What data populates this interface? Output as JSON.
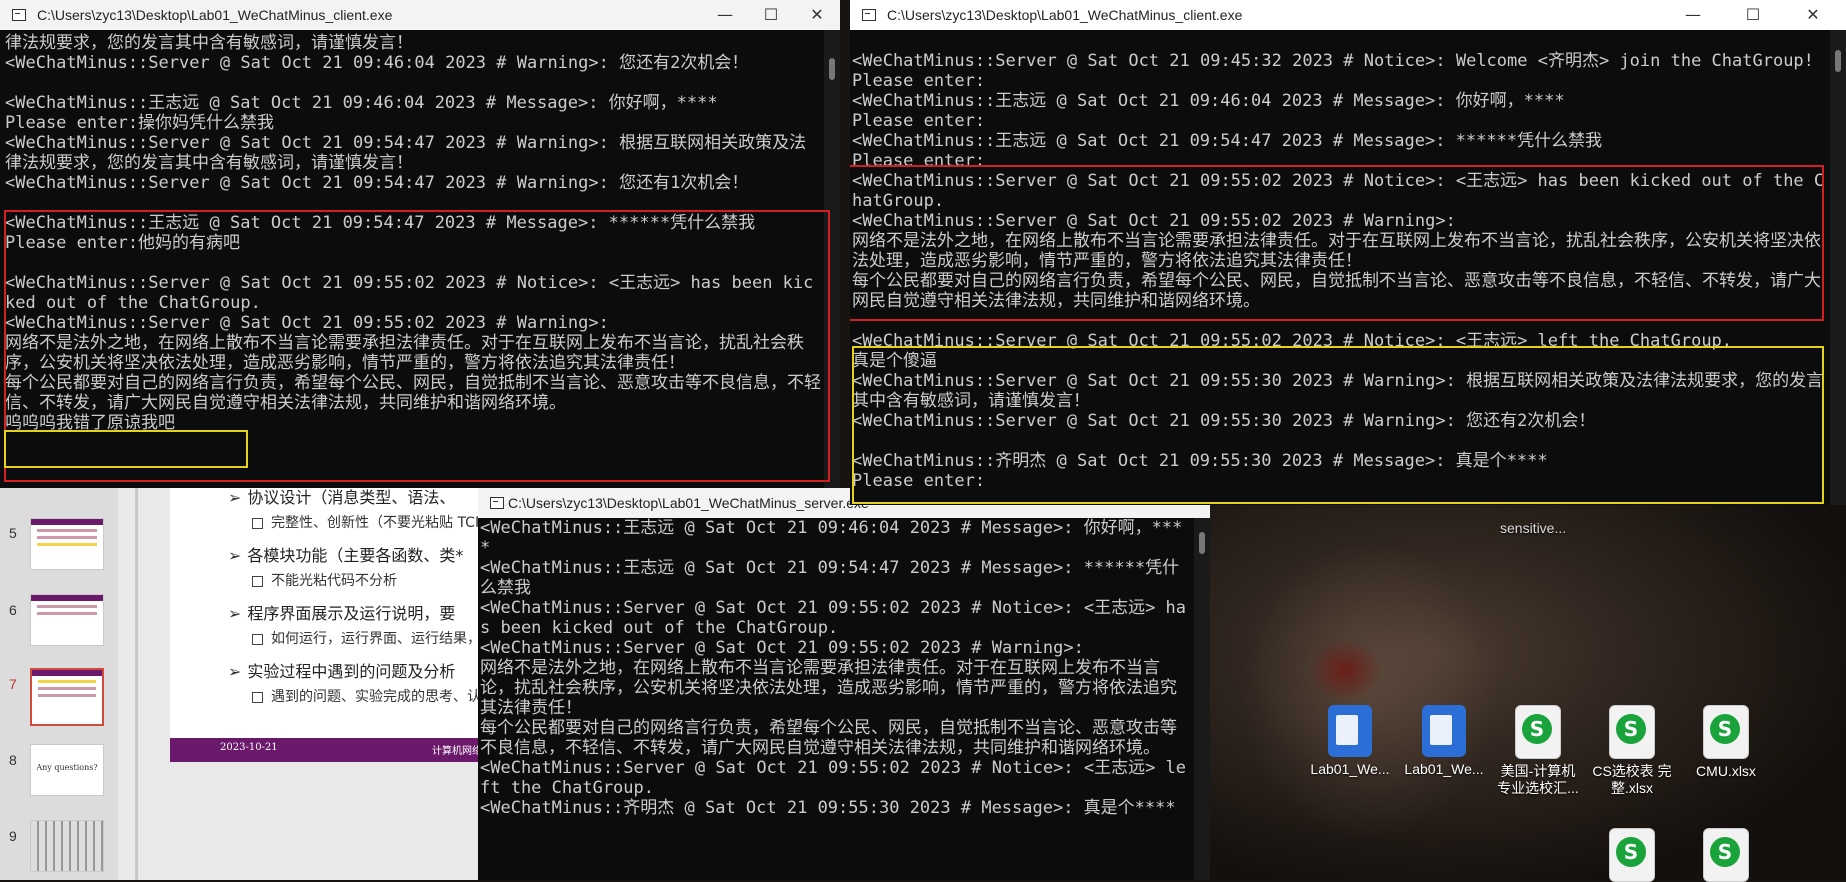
{
  "win1": {
    "title": "C:\\Users\\zyc13\\Desktop\\Lab01_WeChatMinus_client.exe",
    "console": "律法规要求，您的发言其中含有敏感词，请谨慎发言！\n<WeChatMinus::Server @ Sat Oct 21 09:46:04 2023 # Warning>: 您还有2次机会！\n\n<WeChatMinus::王志远 @ Sat Oct 21 09:46:04 2023 # Message>: 你好啊，****\nPlease enter:操你妈凭什么禁我\n<WeChatMinus::Server @ Sat Oct 21 09:54:47 2023 # Warning>: 根据互联网相关政策及法律法规要求，您的发言其中含有敏感词，请谨慎发言！\n<WeChatMinus::Server @ Sat Oct 21 09:54:47 2023 # Warning>: 您还有1次机会！\n\n<WeChatMinus::王志远 @ Sat Oct 21 09:54:47 2023 # Message>: ******凭什么禁我\nPlease enter:他妈的有病吧\n\n<WeChatMinus::Server @ Sat Oct 21 09:55:02 2023 # Notice>: <王志远> has been kicked out of the ChatGroup.\n<WeChatMinus::Server @ Sat Oct 21 09:55:02 2023 # Warning>:\n网络不是法外之地，在网络上散布不当言论需要承担法律责任。对于在互联网上发布不当言论，扰乱社会秩序，公安机关将坚决依法处理，造成恶劣影响，情节严重的，警方将依法追究其法律责任！\n每个公民都要对自己的网络言行负责，希望每个公民、网民，自觉抵制不当言论、恶意攻击等不良信息，不轻信、不转发，请广大网民自觉遵守相关法律法规，共同维护和谐网络环境。\n呜呜呜我错了原谅我吧"
  },
  "win2": {
    "title": "C:\\Users\\zyc13\\Desktop\\Lab01_WeChatMinus_client.exe",
    "console": "\n<WeChatMinus::Server @ Sat Oct 21 09:45:32 2023 # Notice>: Welcome <齐明杰> join the ChatGroup!\nPlease enter:\n<WeChatMinus::王志远 @ Sat Oct 21 09:46:04 2023 # Message>: 你好啊，****\nPlease enter:\n<WeChatMinus::王志远 @ Sat Oct 21 09:54:47 2023 # Message>: ******凭什么禁我\nPlease enter:\n<WeChatMinus::Server @ Sat Oct 21 09:55:02 2023 # Notice>: <王志远> has been kicked out of the ChatGroup.\n<WeChatMinus::Server @ Sat Oct 21 09:55:02 2023 # Warning>:\n网络不是法外之地，在网络上散布不当言论需要承担法律责任。对于在互联网上发布不当言论，扰乱社会秩序，公安机关将坚决依法处理，造成恶劣影响，情节严重的，警方将依法追究其法律责任！\n每个公民都要对自己的网络言行负责，希望每个公民、网民，自觉抵制不当言论、恶意攻击等不良信息，不轻信、不转发，请广大网民自觉遵守相关法律法规，共同维护和谐网络环境。\n\n<WeChatMinus::Server @ Sat Oct 21 09:55:02 2023 # Notice>: <王志远> left the ChatGroup.\n真是个傻逼\n<WeChatMinus::Server @ Sat Oct 21 09:55:30 2023 # Warning>: 根据互联网相关政策及法律法规要求，您的发言其中含有敏感词，请谨慎发言！\n<WeChatMinus::Server @ Sat Oct 21 09:55:30 2023 # Warning>: 您还有2次机会！\n\n<WeChatMinus::齐明杰 @ Sat Oct 21 09:55:30 2023 # Message>: 真是个****\nPlease enter:"
  },
  "win3": {
    "title": "C:\\Users\\zyc13\\Desktop\\Lab01_WeChatMinus_server.exe",
    "console": "<WeChatMinus::王志远 @ Sat Oct 21 09:46:04 2023 # Message>: 你好啊，****\n<WeChatMinus::王志远 @ Sat Oct 21 09:54:47 2023 # Message>: ******凭什么禁我\n<WeChatMinus::Server @ Sat Oct 21 09:55:02 2023 # Notice>: <王志远> has been kicked out of the ChatGroup.\n<WeChatMinus::Server @ Sat Oct 21 09:55:02 2023 # Warning>:\n网络不是法外之地，在网络上散布不当言论需要承担法律责任。对于在互联网上发布不当言论，扰乱社会秩序，公安机关将坚决依法处理，造成恶劣影响，情节严重的，警方将依法追究其法律责任！\n每个公民都要对自己的网络言行负责，希望每个公民、网民，自觉抵制不当言论、恶意攻击等不良信息，不轻信、不转发，请广大网民自觉遵守相关法律法规，共同维护和谐网络环境。\n<WeChatMinus::Server @ Sat Oct 21 09:55:02 2023 # Notice>: <王志远> left the ChatGroup.\n<WeChatMinus::齐明杰 @ Sat Oct 21 09:55:30 2023 # Message>: 真是个****"
  },
  "window_controls": {
    "minimize": "—",
    "maximize": "☐",
    "close": "✕"
  },
  "ppt": {
    "thumb_numbers": [
      "5",
      "6",
      "7",
      "8",
      "9"
    ],
    "bullets": [
      "协议设计（消息类型、语法、",
      "完整性、创新性（不要光粘贴 TCP",
      "各模块功能（主要各函数、类*",
      "不能光粘代码不分析",
      "程序界面展示及运行说明，要",
      "如何运行，运行界面、运行结果，",
      "实验过程中遇到的问题及分析",
      "遇到的问题、实验完成的思考、认"
    ],
    "footer_date": "2023-10-21",
    "footer_right": "计算机网络",
    "thumb8_text": "Any questions?"
  },
  "desktop": {
    "icons": [
      {
        "label": "Lab01_We...",
        "kind": "word"
      },
      {
        "label": "Lab01_We...",
        "kind": "word"
      },
      {
        "label": "美国-计算机专业选校汇...",
        "kind": "xls"
      },
      {
        "label": "CS选校表 完整.xlsx",
        "kind": "xls"
      },
      {
        "label": "CMU.xlsx",
        "kind": "xls"
      }
    ],
    "top_label": "sensitive..."
  }
}
